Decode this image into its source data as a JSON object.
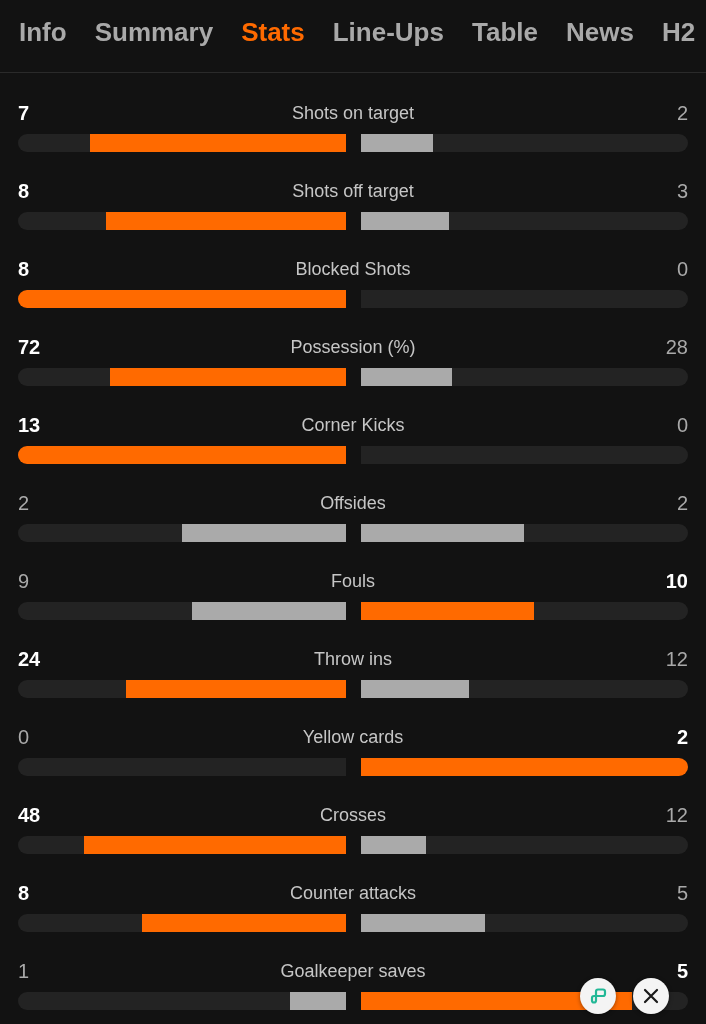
{
  "tabs": [
    {
      "label": "Info",
      "selected": false
    },
    {
      "label": "Summary",
      "selected": false
    },
    {
      "label": "Stats",
      "selected": true
    },
    {
      "label": "Line-Ups",
      "selected": false
    },
    {
      "label": "Table",
      "selected": false
    },
    {
      "label": "News",
      "selected": false
    },
    {
      "label": "H2",
      "selected": false
    }
  ],
  "stats": [
    {
      "label": "Shots on target",
      "home": {
        "value": "7",
        "level": 0.78,
        "leading": true
      },
      "away": {
        "value": "2",
        "level": 0.22,
        "leading": false
      }
    },
    {
      "label": "Shots off target",
      "home": {
        "value": "8",
        "level": 0.73,
        "leading": true
      },
      "away": {
        "value": "3",
        "level": 0.27,
        "leading": false
      }
    },
    {
      "label": "Blocked Shots",
      "home": {
        "value": "8",
        "level": 1,
        "leading": true
      },
      "away": {
        "value": "0",
        "leading": false
      }
    },
    {
      "label": "Possession (%)",
      "home": {
        "value": "72",
        "level": 0.72,
        "leading": true
      },
      "away": {
        "value": "28",
        "level": 0.28,
        "leading": false
      }
    },
    {
      "label": "Corner Kicks",
      "home": {
        "value": "13",
        "level": 1,
        "leading": true
      },
      "away": {
        "value": "0",
        "leading": false
      }
    },
    {
      "label": "Offsides",
      "home": {
        "value": "2",
        "level": 0.5,
        "leading": false
      },
      "away": {
        "value": "2",
        "level": 0.5,
        "leading": false
      }
    },
    {
      "label": "Fouls",
      "home": {
        "value": "9",
        "level": 0.47,
        "leading": false
      },
      "away": {
        "value": "10",
        "level": 0.53,
        "leading": true
      }
    },
    {
      "label": "Throw ins",
      "home": {
        "value": "24",
        "level": 0.67,
        "leading": true
      },
      "away": {
        "value": "12",
        "level": 0.33,
        "leading": false
      }
    },
    {
      "label": "Yellow cards",
      "home": {
        "value": "0",
        "leading": false
      },
      "away": {
        "value": "2",
        "level": 1,
        "leading": true
      }
    },
    {
      "label": "Crosses",
      "home": {
        "value": "48",
        "level": 0.8,
        "leading": true
      },
      "away": {
        "value": "12",
        "level": 0.2,
        "leading": false
      }
    },
    {
      "label": "Counter attacks",
      "home": {
        "value": "8",
        "level": 0.62,
        "leading": true
      },
      "away": {
        "value": "5",
        "level": 0.38,
        "leading": false
      }
    },
    {
      "label": "Goalkeeper saves",
      "home": {
        "value": "1",
        "level": 0.17,
        "leading": false
      },
      "away": {
        "value": "5",
        "level": 0.83,
        "leading": true
      }
    }
  ]
}
